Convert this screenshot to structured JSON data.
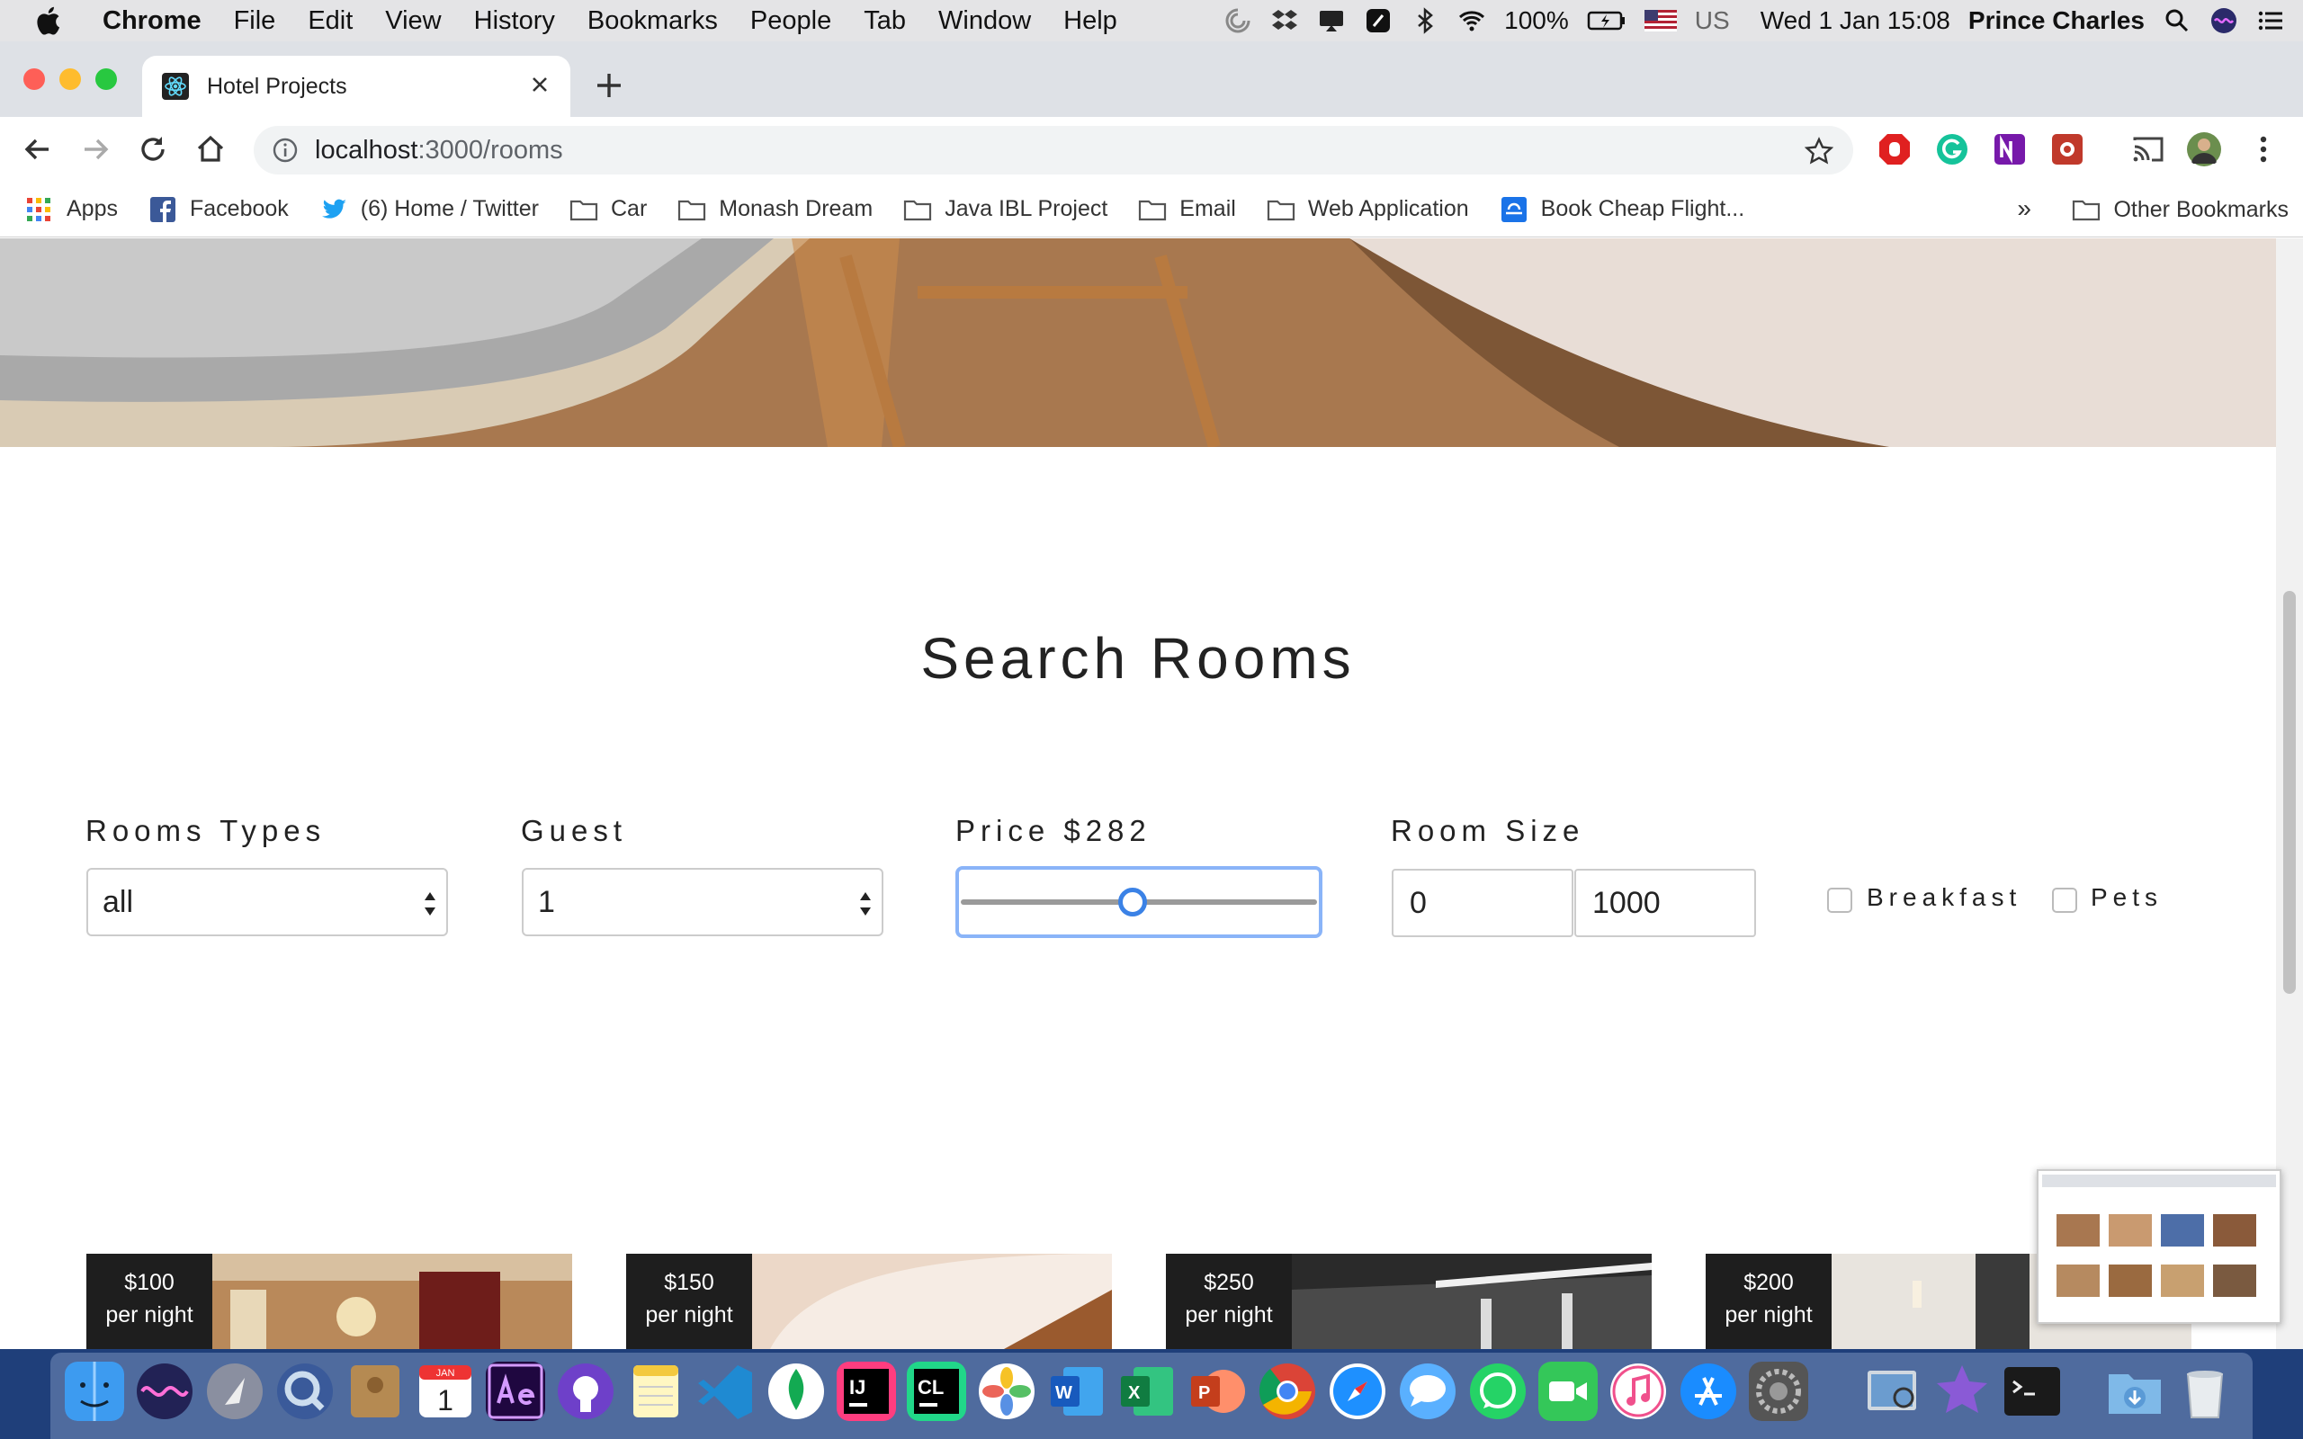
{
  "menubar": {
    "app": "Chrome",
    "items": [
      "File",
      "Edit",
      "View",
      "History",
      "Bookmarks",
      "People",
      "Tab",
      "Window",
      "Help"
    ],
    "battery": "100%",
    "input_source": "US",
    "datetime": "Wed 1 Jan  15:08",
    "user": "Prince Charles"
  },
  "tab": {
    "title": "Hotel Projects"
  },
  "address": {
    "host": "localhost",
    "path": ":3000/rooms"
  },
  "bookmarks": {
    "items": [
      "Apps",
      "Facebook",
      "(6) Home / Twitter",
      "Car",
      "Monash Dream",
      "Java IBL Project",
      "Email",
      "Web Application",
      "Book Cheap Flight..."
    ],
    "more": "»",
    "other": "Other Bookmarks"
  },
  "page": {
    "title": "Search Rooms",
    "filters": {
      "room_types_label": "Rooms Types",
      "room_types_value": "all",
      "guest_label": "Guest",
      "guest_value": "1",
      "price_label": "Price $282",
      "price_fraction": 0.48,
      "room_size_label": "Room Size",
      "min_size": "0",
      "max_size": "1000",
      "breakfast_label": "Breakfast",
      "pets_label": "Pets"
    },
    "rooms": [
      {
        "price": "$100",
        "unit": "per night"
      },
      {
        "price": "$150",
        "unit": "per night"
      },
      {
        "price": "$250",
        "unit": "per night"
      },
      {
        "price": "$200",
        "unit": "per night"
      }
    ]
  },
  "dock_apps": [
    "finder-icon",
    "siri-icon",
    "launchpad-icon",
    "quicktime-icon",
    "contacts-icon",
    "calendar-icon",
    "after-effects-icon",
    "github-desktop-icon",
    "notes-icon",
    "vscode-icon",
    "mongodb-compass-icon",
    "intellij-icon",
    "clion-icon",
    "photos-icon",
    "word-icon",
    "excel-icon",
    "powerpoint-icon",
    "chrome-icon",
    "safari-icon",
    "messages-icon",
    "whatsapp-icon",
    "facetime-icon",
    "itunes-icon",
    "app-store-icon",
    "system-preferences-icon",
    "preview-icon",
    "imovie-icon",
    "terminal-icon",
    "downloads-folder-icon",
    "trash-icon"
  ],
  "dock_calendar_month": "JAN",
  "dock_calendar_day": "1"
}
